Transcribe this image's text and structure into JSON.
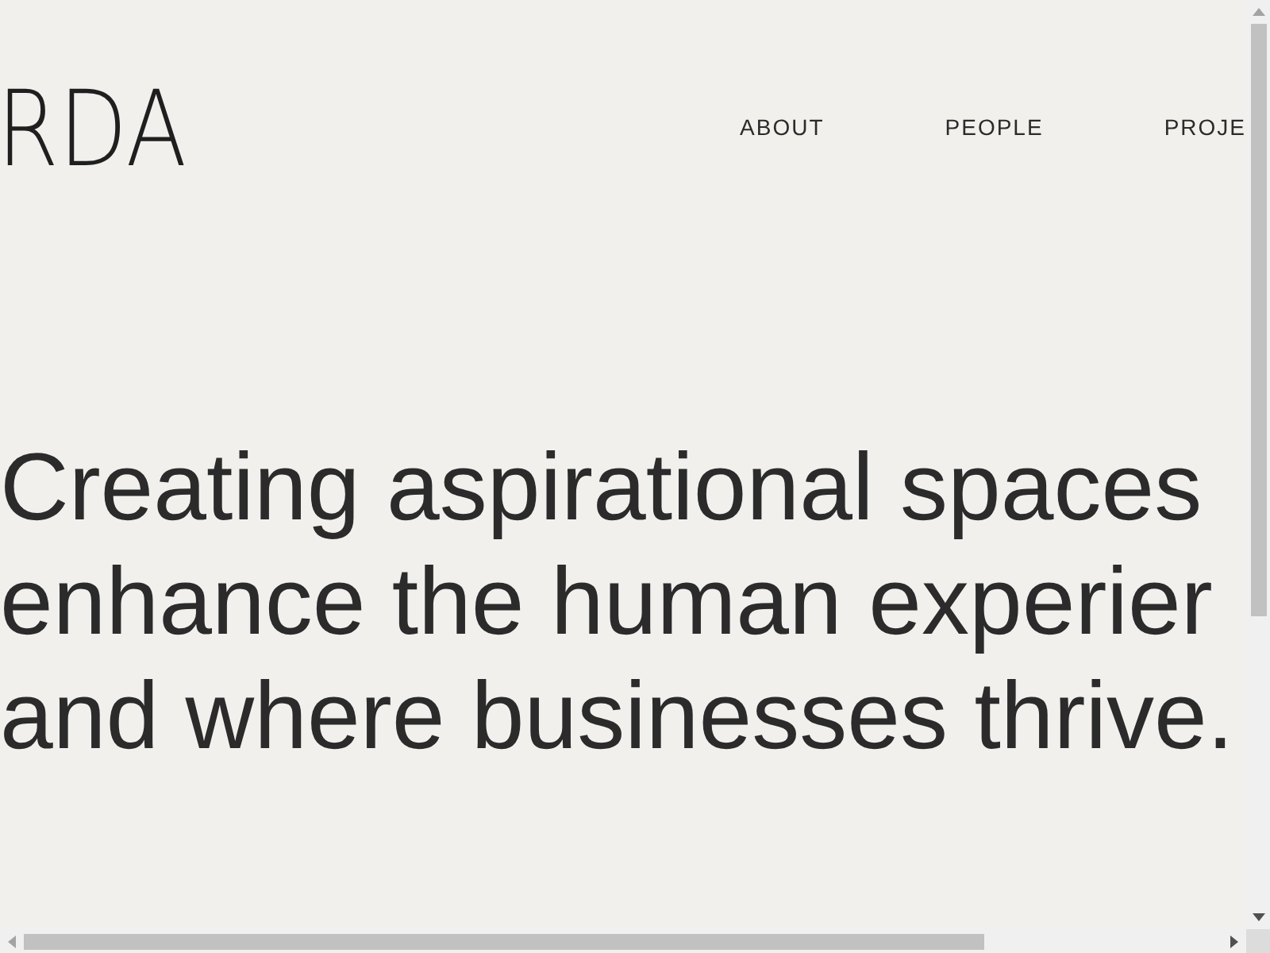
{
  "logo": {
    "text": "RDA"
  },
  "nav": [
    {
      "label": "ABOUT"
    },
    {
      "label": "PEOPLE"
    },
    {
      "label": "PROJE"
    }
  ],
  "headline": {
    "lines": [
      "Creating aspirational spaces",
      "enhance the human experier",
      "and where businesses thrive."
    ]
  }
}
